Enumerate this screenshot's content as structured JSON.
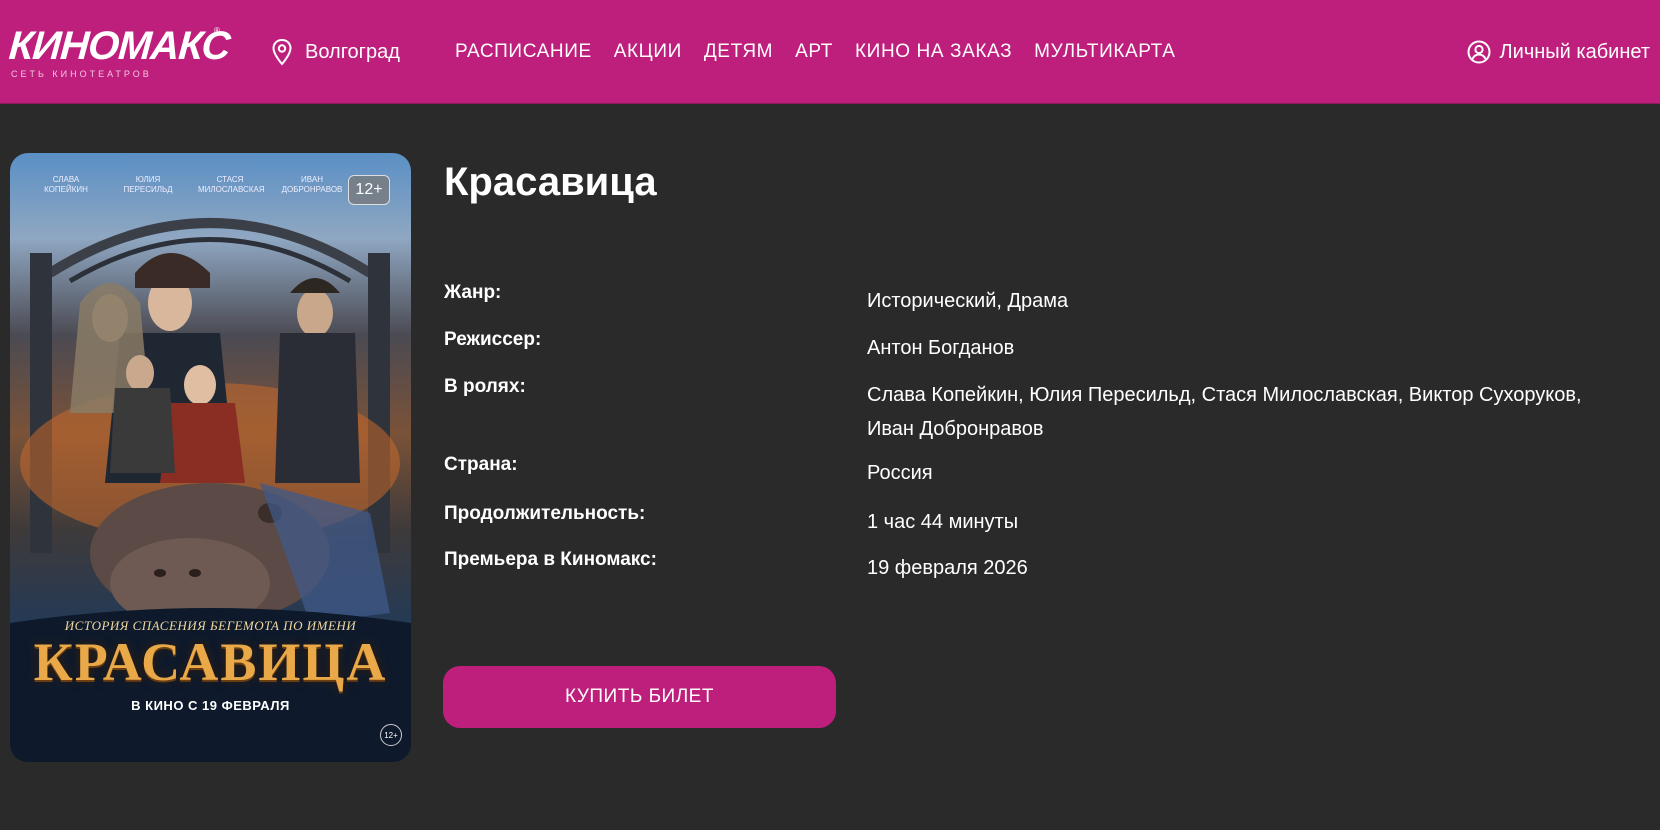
{
  "header": {
    "logo_main": "КИНОМАКС",
    "logo_registered": "®",
    "logo_sub": "СЕТЬ КИНОТЕАТРОВ",
    "city": "Волгоград",
    "nav": [
      "РАСПИСАНИЕ",
      "АКЦИИ",
      "ДЕТЯМ",
      "АРТ",
      "КИНО НА ЗАКАЗ",
      "МУЛЬТИКАРТА"
    ],
    "account_label": "Личный кабинет",
    "brand_color": "#be1f7c"
  },
  "poster": {
    "age_rating": "12+",
    "actors": [
      [
        "СЛАВА",
        "КОПЕЙКИН"
      ],
      [
        "ЮЛИЯ",
        "ПЕРЕСИЛЬД"
      ],
      [
        "СТАСЯ",
        "МИЛОСЛАВСКАЯ"
      ],
      [
        "ИВАН",
        "ДОБРОНРАВОВ"
      ]
    ],
    "tagline": "ИСТОРИЯ СПАСЕНИЯ БЕГЕМОТА ПО ИМЕНИ",
    "title": "КРАСАВИЦА",
    "release": "В КИНО С 19 ФЕВРАЛЯ",
    "bottom_age": "12+"
  },
  "movie": {
    "title": "Красавица",
    "details": [
      {
        "label": "Жанр:",
        "value": "Исторический, Драма"
      },
      {
        "label": "Режиссер:",
        "value": "Антон Богданов"
      },
      {
        "label": "В ролях:",
        "value": "Слава Копейкин, Юлия Пересильд, Стася Милославская, Виктор Сухоруков, Иван Добронравов"
      },
      {
        "label": "Страна:",
        "value": "Россия"
      },
      {
        "label": "Продолжительность:",
        "value": "1 час 44 минуты"
      },
      {
        "label": "Премьера в Киномакс:",
        "value": "19 февраля 2026"
      }
    ],
    "buy_label": "КУПИТЬ БИЛЕТ"
  }
}
